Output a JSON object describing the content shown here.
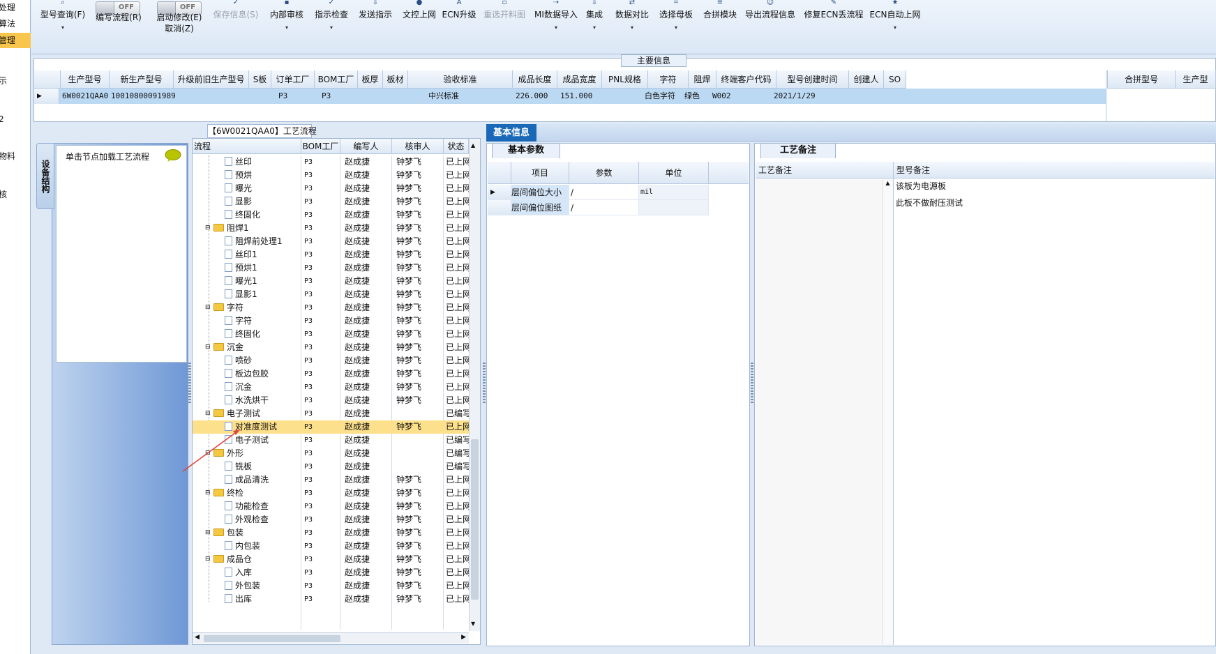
{
  "nav": {
    "items": [
      "处理",
      "算法",
      "管理",
      "示",
      "2",
      "物料",
      "核"
    ]
  },
  "toolbar": {
    "buttons": [
      {
        "label": "型号查询(F)",
        "drop": "▾"
      },
      {
        "label": "编写流程(R)",
        "toggle": "OFF"
      },
      {
        "label": "启动修改(E)",
        "sub": "取消(Z)",
        "toggle": "OFF"
      },
      {
        "label": "保存信息(S)"
      },
      {
        "label": "内部审核",
        "drop": "▾"
      },
      {
        "label": "指示检查",
        "drop": "▾"
      },
      {
        "label": "发送指示"
      },
      {
        "label": "文控上网"
      },
      {
        "label": "ECN升级"
      },
      {
        "label": "重选开料图"
      },
      {
        "label": "MI数据导入",
        "drop": "▾"
      },
      {
        "label": "集成",
        "drop": "▾"
      },
      {
        "label": "数据对比",
        "drop": "▾"
      },
      {
        "label": "选择母板",
        "drop": "▾"
      },
      {
        "label": "合拼模块"
      },
      {
        "label": "导出流程信息"
      },
      {
        "label": "修复ECN丢流程"
      },
      {
        "label": "ECN自动上网",
        "drop": "▾"
      }
    ]
  },
  "main_info": {
    "title": "主要信息",
    "columns": [
      "生产型号",
      "新生产型号",
      "升级前旧生产型号",
      "S板",
      "订单工厂",
      "BOM工厂",
      "板厚",
      "板材",
      "验收标准",
      "成品长度",
      "成品宽度",
      "PNL规格",
      "字符",
      "阻焊",
      "终端客户代码",
      "型号创建时间",
      "创建人",
      "SO"
    ],
    "row": [
      "6W0021QAA0",
      "10010800091989",
      "",
      "",
      "P3",
      "P3",
      "",
      "",
      "中兴标准",
      "226.000",
      "151.000",
      "",
      "白色字符",
      "绿色",
      "W002",
      "2021/1/29",
      "",
      ""
    ],
    "side_columns": [
      "合拼型号",
      "生产型"
    ]
  },
  "side_panel": {
    "tab": "设备结构",
    "card_title": "单击节点加载工艺流程"
  },
  "process": {
    "title": "【6W0021QAA0】工艺流程",
    "columns": [
      "流程",
      "BOM工厂",
      "编写人",
      "核审人",
      "状态"
    ],
    "rows": [
      {
        "name": "丝印",
        "level": 2,
        "factory": "P3",
        "writer": "赵成捷",
        "reviewer": "钟梦飞",
        "status": "已上网"
      },
      {
        "name": "预烘",
        "level": 2,
        "factory": "P3",
        "writer": "赵成捷",
        "reviewer": "钟梦飞",
        "status": "已上网"
      },
      {
        "name": "曝光",
        "level": 2,
        "factory": "P3",
        "writer": "赵成捷",
        "reviewer": "钟梦飞",
        "status": "已上网"
      },
      {
        "name": "显影",
        "level": 2,
        "factory": "P3",
        "writer": "赵成捷",
        "reviewer": "钟梦飞",
        "status": "已上网"
      },
      {
        "name": "终固化",
        "level": 2,
        "factory": "P3",
        "writer": "赵成捷",
        "reviewer": "钟梦飞",
        "status": "已上网"
      },
      {
        "name": "阻焊1",
        "level": 1,
        "factory": "P3",
        "writer": "赵成捷",
        "reviewer": "钟梦飞",
        "status": "已上网"
      },
      {
        "name": "阻焊前处理1",
        "level": 2,
        "factory": "P3",
        "writer": "赵成捷",
        "reviewer": "钟梦飞",
        "status": "已上网"
      },
      {
        "name": "丝印1",
        "level": 2,
        "factory": "P3",
        "writer": "赵成捷",
        "reviewer": "钟梦飞",
        "status": "已上网"
      },
      {
        "name": "预烘1",
        "level": 2,
        "factory": "P3",
        "writer": "赵成捷",
        "reviewer": "钟梦飞",
        "status": "已上网"
      },
      {
        "name": "曝光1",
        "level": 2,
        "factory": "P3",
        "writer": "赵成捷",
        "reviewer": "钟梦飞",
        "status": "已上网"
      },
      {
        "name": "显影1",
        "level": 2,
        "factory": "P3",
        "writer": "赵成捷",
        "reviewer": "钟梦飞",
        "status": "已上网"
      },
      {
        "name": "字符",
        "level": 1,
        "factory": "P3",
        "writer": "赵成捷",
        "reviewer": "钟梦飞",
        "status": "已上网"
      },
      {
        "name": "字符",
        "level": 2,
        "factory": "P3",
        "writer": "赵成捷",
        "reviewer": "钟梦飞",
        "status": "已上网"
      },
      {
        "name": "终固化",
        "level": 2,
        "factory": "P3",
        "writer": "赵成捷",
        "reviewer": "钟梦飞",
        "status": "已上网"
      },
      {
        "name": "沉金",
        "level": 1,
        "factory": "P3",
        "writer": "赵成捷",
        "reviewer": "钟梦飞",
        "status": "已上网"
      },
      {
        "name": "喷砂",
        "level": 2,
        "factory": "P3",
        "writer": "赵成捷",
        "reviewer": "钟梦飞",
        "status": "已上网"
      },
      {
        "name": "板边包胶",
        "level": 2,
        "factory": "P3",
        "writer": "赵成捷",
        "reviewer": "钟梦飞",
        "status": "已上网"
      },
      {
        "name": "沉金",
        "level": 2,
        "factory": "P3",
        "writer": "赵成捷",
        "reviewer": "钟梦飞",
        "status": "已上网"
      },
      {
        "name": "水洗烘干",
        "level": 2,
        "factory": "P3",
        "writer": "赵成捷",
        "reviewer": "钟梦飞",
        "status": "已上网"
      },
      {
        "name": "电子测试",
        "level": 1,
        "factory": "P3",
        "writer": "赵成捷",
        "reviewer": "",
        "status": "已编写"
      },
      {
        "name": "对准度测试",
        "level": 2,
        "factory": "P3",
        "writer": "赵成捷",
        "reviewer": "钟梦飞",
        "status": "已上网",
        "selected": true
      },
      {
        "name": "电子测试",
        "level": 2,
        "factory": "P3",
        "writer": "赵成捷",
        "reviewer": "",
        "status": "已编写"
      },
      {
        "name": "外形",
        "level": 1,
        "factory": "P3",
        "writer": "赵成捷",
        "reviewer": "",
        "status": "已编写"
      },
      {
        "name": "铣板",
        "level": 2,
        "factory": "P3",
        "writer": "赵成捷",
        "reviewer": "",
        "status": "已编写"
      },
      {
        "name": "成品清洗",
        "level": 2,
        "factory": "P3",
        "writer": "赵成捷",
        "reviewer": "钟梦飞",
        "status": "已上网"
      },
      {
        "name": "终检",
        "level": 1,
        "factory": "P3",
        "writer": "赵成捷",
        "reviewer": "钟梦飞",
        "status": "已上网"
      },
      {
        "name": "功能检查",
        "level": 2,
        "factory": "P3",
        "writer": "赵成捷",
        "reviewer": "钟梦飞",
        "status": "已上网"
      },
      {
        "name": "外观检查",
        "level": 2,
        "factory": "P3",
        "writer": "赵成捷",
        "reviewer": "钟梦飞",
        "status": "已上网"
      },
      {
        "name": "包装",
        "level": 1,
        "factory": "P3",
        "writer": "赵成捷",
        "reviewer": "钟梦飞",
        "status": "已上网"
      },
      {
        "name": "内包装",
        "level": 2,
        "factory": "P3",
        "writer": "赵成捷",
        "reviewer": "钟梦飞",
        "status": "已上网"
      },
      {
        "name": "成品仓",
        "level": 1,
        "factory": "P3",
        "writer": "赵成捷",
        "reviewer": "钟梦飞",
        "status": "已上网"
      },
      {
        "name": "入库",
        "level": 2,
        "factory": "P3",
        "writer": "赵成捷",
        "reviewer": "钟梦飞",
        "status": "已上网"
      },
      {
        "name": "外包装",
        "level": 2,
        "factory": "P3",
        "writer": "赵成捷",
        "reviewer": "钟梦飞",
        "status": "已上网"
      },
      {
        "name": "出库",
        "level": 2,
        "factory": "P3",
        "writer": "赵成捷",
        "reviewer": "钟梦飞",
        "status": "已上网"
      }
    ]
  },
  "basic_info": {
    "tab": "基本信息",
    "params_tab": "基本参数",
    "param_columns": [
      "项目",
      "参数",
      "单位"
    ],
    "params": [
      {
        "item": "层间偏位大小",
        "value": "/",
        "unit": "mil"
      },
      {
        "item": "层间偏位图纸",
        "value": "/",
        "unit": ""
      }
    ],
    "remarks_tab": "工艺备注",
    "remark_columns": [
      "工艺备注",
      "型号备注"
    ],
    "model_remarks": [
      "该板为电源板",
      "此板不做耐压测试"
    ]
  },
  "colors": {
    "selected_row": "#fde08b",
    "accent": "#1a68b8",
    "grid_row": "#bcd9f4"
  }
}
